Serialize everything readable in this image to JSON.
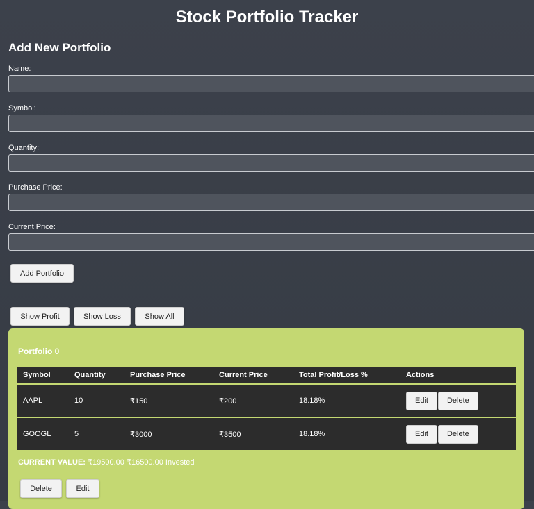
{
  "app": {
    "title": "Stock Portfolio Tracker"
  },
  "form": {
    "heading": "Add New Portfolio",
    "fields": [
      {
        "label": "Name:",
        "value": "",
        "placeholder": ""
      },
      {
        "label": "Symbol:",
        "value": "",
        "placeholder": ""
      },
      {
        "label": "Quantity:",
        "value": "",
        "placeholder": ""
      },
      {
        "label": "Purchase Price:",
        "value": "",
        "placeholder": ""
      },
      {
        "label": "Current Price:",
        "value": "",
        "placeholder": ""
      }
    ],
    "submit_label": "Add Portfolio"
  },
  "filters": {
    "show_profit": "Show Profit",
    "show_loss": "Show Loss",
    "show_all": "Show All"
  },
  "portfolio": {
    "title": "Portfolio 0",
    "columns": [
      "Symbol",
      "Quantity",
      "Purchase Price",
      "Current Price",
      "Total Profit/Loss %",
      "Actions"
    ],
    "rows": [
      {
        "symbol": "AAPL",
        "quantity": "10",
        "purchase_price": "₹150",
        "current_price": "₹200",
        "profit_loss": "18.18%",
        "edit_label": "Edit",
        "delete_label": "Delete"
      },
      {
        "symbol": "GOOGL",
        "quantity": "5",
        "purchase_price": "₹3000",
        "current_price": "₹3500",
        "profit_loss": "18.18%",
        "edit_label": "Edit",
        "delete_label": "Delete"
      }
    ],
    "current_value_label": "CURRENT VALUE:",
    "current_value_text": "₹19500.00 ₹16500.00 Invested",
    "delete_label": "Delete",
    "edit_label": "Edit"
  },
  "colors": {
    "background": "#3c414b",
    "card": "#c4d872",
    "table_row": "#2c2c2c",
    "input": "#4f545d"
  }
}
